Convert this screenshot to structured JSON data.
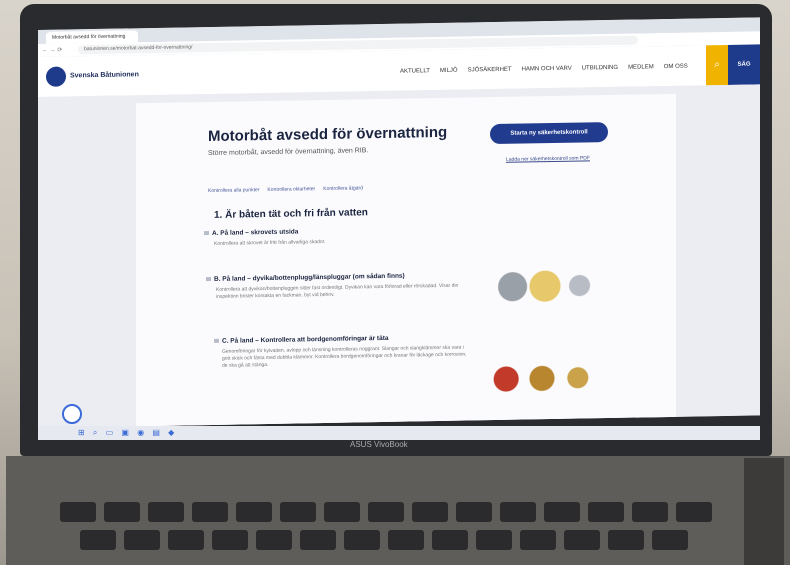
{
  "browser": {
    "tab_title": "Motorbåt avsedd för övernattning",
    "url": "batunionen.se/motorbat-avsedd-for-overnattning/"
  },
  "header": {
    "brand": "Svenska Båtunionen",
    "nav": [
      "AKTUELLT",
      "MILJÖ",
      "SJÖSÄKERHET",
      "HAMN OCH VARV",
      "UTBILDNING",
      "MEDLEM",
      "OM OSS"
    ],
    "lang": "SÄG"
  },
  "content": {
    "title": "Motorbåt avsedd för övernattning",
    "subtitle": "Större motorbåt, avsedd för övernattning, även RIB.",
    "start_button": "Starta ny säkerhetskontroll",
    "link": "Ladda ner säkerhetskontroll som PDF",
    "toolbar": [
      "Kontrollera alla punkter",
      "Kontrollera oklarheter",
      "Kontrollera åtgärd"
    ],
    "section_title": "1. Är båten tät och fri från vatten",
    "items": [
      {
        "title": "A. På land – skrovets utsida",
        "text": "Kontrollera att skrovet är fritt från allvarliga skador."
      },
      {
        "title": "B. På land – dyvika/bottenplugg/länspluggar (om sådan finns)",
        "text": "Kontrollera att dyvikan/bottenpluggen sitter fast ordentligt. Dyvikan kan vara förlorad eller rörskadad. Visar din inspektion brister kontakta en fackman, byt vid behov."
      },
      {
        "title": "C. På land – Kontrollera att bordgenomföringar är täta",
        "text": "Genomföringar för kylvatten, avlopp och länsning kontrolleras noggrant. Slangar och slangklämmor ska vara i gott skick och fästa med dubbla klämmor. Kontrollera bordgenomföringar och kranar för läckage och korrosion, de ska gå att stänga."
      }
    ]
  },
  "device": {
    "brand_text": "ASUS VivoBook"
  },
  "colors": {
    "accent": "#213b8f",
    "search": "#f0b400"
  }
}
